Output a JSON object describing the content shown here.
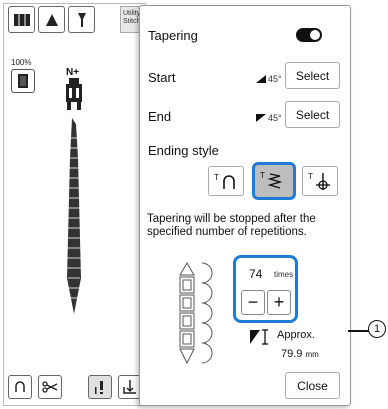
{
  "left_panel": {
    "utility_tab_label": "Utility Stitch",
    "zoom": "100%",
    "needle_position": "N+"
  },
  "dialog": {
    "title": "Tapering",
    "toggle_state": "on",
    "start": {
      "label": "Start",
      "angle": "45°",
      "button": "Select"
    },
    "end": {
      "label": "End",
      "angle": "45°",
      "button": "Select"
    },
    "ending_style": {
      "label": "Ending style",
      "options": [
        "reverse-stitch",
        "repeat-count",
        "locking-stitch"
      ],
      "selected": "repeat-count"
    },
    "info": "Tapering will be stopped after the specified number of repetitions.",
    "counter": {
      "value": "74",
      "unit": "times",
      "minus": "−",
      "plus": "+"
    },
    "approx": {
      "label": "Approx.",
      "value": "79.9",
      "unit": "mm"
    },
    "close_button": "Close"
  },
  "callout": {
    "number": "1"
  },
  "colors": {
    "accent": "#1e7bd6",
    "toggle": "#111111"
  }
}
